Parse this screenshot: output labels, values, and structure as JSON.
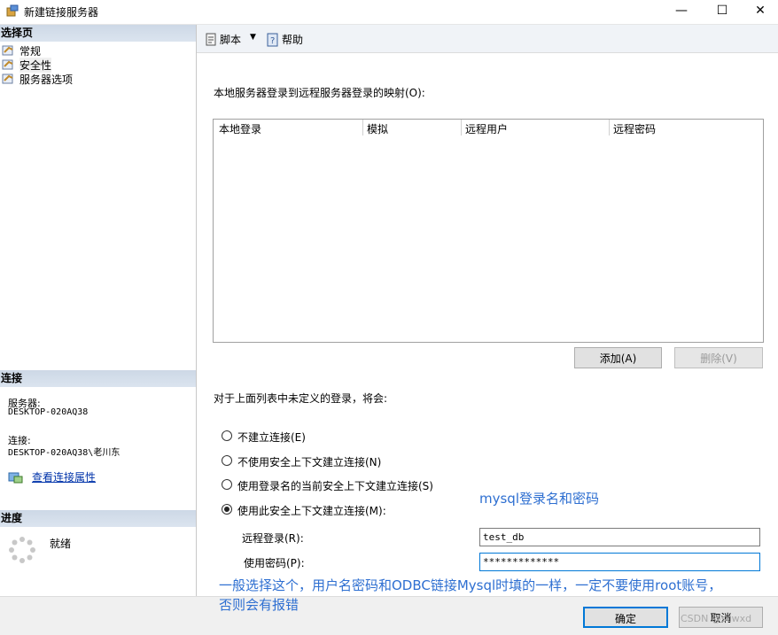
{
  "window": {
    "title": "新建链接服务器",
    "minimize": "—",
    "maximize": "☐",
    "close": "✕"
  },
  "left": {
    "select_page_header": "选择页",
    "pages": [
      {
        "label": "常规"
      },
      {
        "label": "安全性"
      },
      {
        "label": "服务器选项"
      }
    ],
    "connection_header": "连接",
    "server_label": "服务器:",
    "server_value": "DESKTOP-020AQ38",
    "connection_label": "连接:",
    "connection_value": "DESKTOP-020AQ38\\老川东",
    "view_props_link": "查看连接属性",
    "progress_header": "进度",
    "progress_status": "就绪"
  },
  "toolbar": {
    "script_label": "脚本",
    "dropdown_arrow": "▼",
    "help_label": "帮助"
  },
  "main": {
    "mapping_label": "本地服务器登录到远程服务器登录的映射(O):",
    "grid_columns": [
      "本地登录",
      "模拟",
      "远程用户",
      "远程密码"
    ],
    "add_button": "添加(A)",
    "delete_button": "删除(V)",
    "undefined_label": "对于上面列表中未定义的登录，将会:",
    "radio_options": [
      {
        "label": "不建立连接(E)",
        "checked": false
      },
      {
        "label": "不使用安全上下文建立连接(N)",
        "checked": false
      },
      {
        "label": "使用登录名的当前安全上下文建立连接(S)",
        "checked": false
      },
      {
        "label": "使用此安全上下文建立连接(M):",
        "checked": true
      }
    ],
    "remote_login_label": "远程登录(R):",
    "remote_login_value": "test_db",
    "password_label": "使用密码(P):",
    "password_value": "*************"
  },
  "annotations": {
    "mysql_note": "mysql登录名和密码",
    "general_note_line1": "一般选择这个，用户名密码和ODBC链接Mysql时填的一样，一定不要使用root账号，",
    "general_note_line2": "否则会有报错"
  },
  "footer": {
    "ok_button": "确定",
    "cancel_button": "取消",
    "watermark": "CSDN @scwxd"
  },
  "colors": {
    "section_header": "#cdd8e6",
    "annotation": "#2e6fd1",
    "link": "#0033aa",
    "focus_border": "#0078d7"
  }
}
